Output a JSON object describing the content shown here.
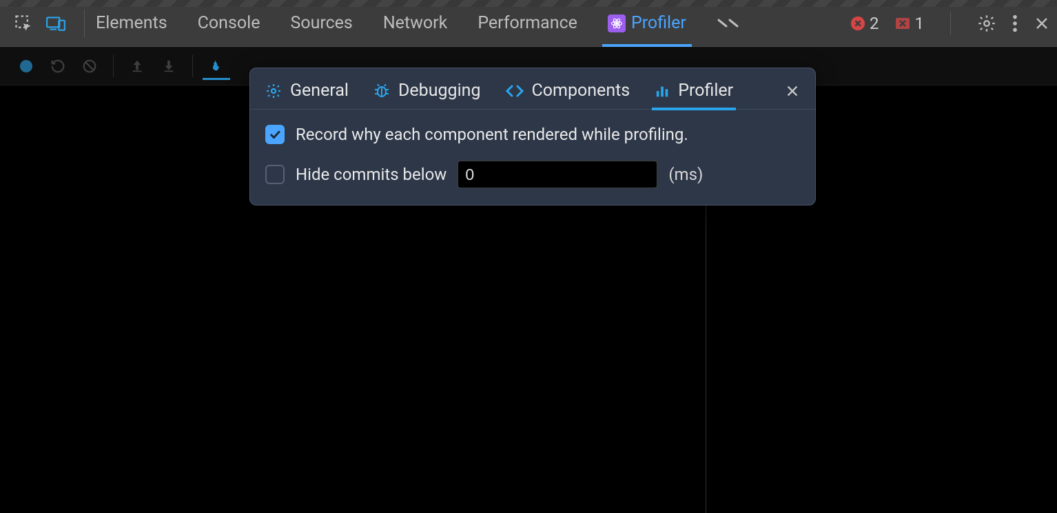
{
  "topbar": {
    "tabs": {
      "elements": "Elements",
      "console": "Console",
      "sources": "Sources",
      "network": "Network",
      "performance": "Performance",
      "profiler": "Profiler"
    },
    "errors_count": "2",
    "warnings_count": "1"
  },
  "settings_popover": {
    "tabs": {
      "general": "General",
      "debugging": "Debugging",
      "components": "Components",
      "profiler": "Profiler"
    },
    "record_why_label": "Record why each component rendered while profiling.",
    "record_why_checked": true,
    "hide_commits_label": "Hide commits below",
    "hide_commits_value": "0",
    "hide_commits_unit": "(ms)"
  }
}
